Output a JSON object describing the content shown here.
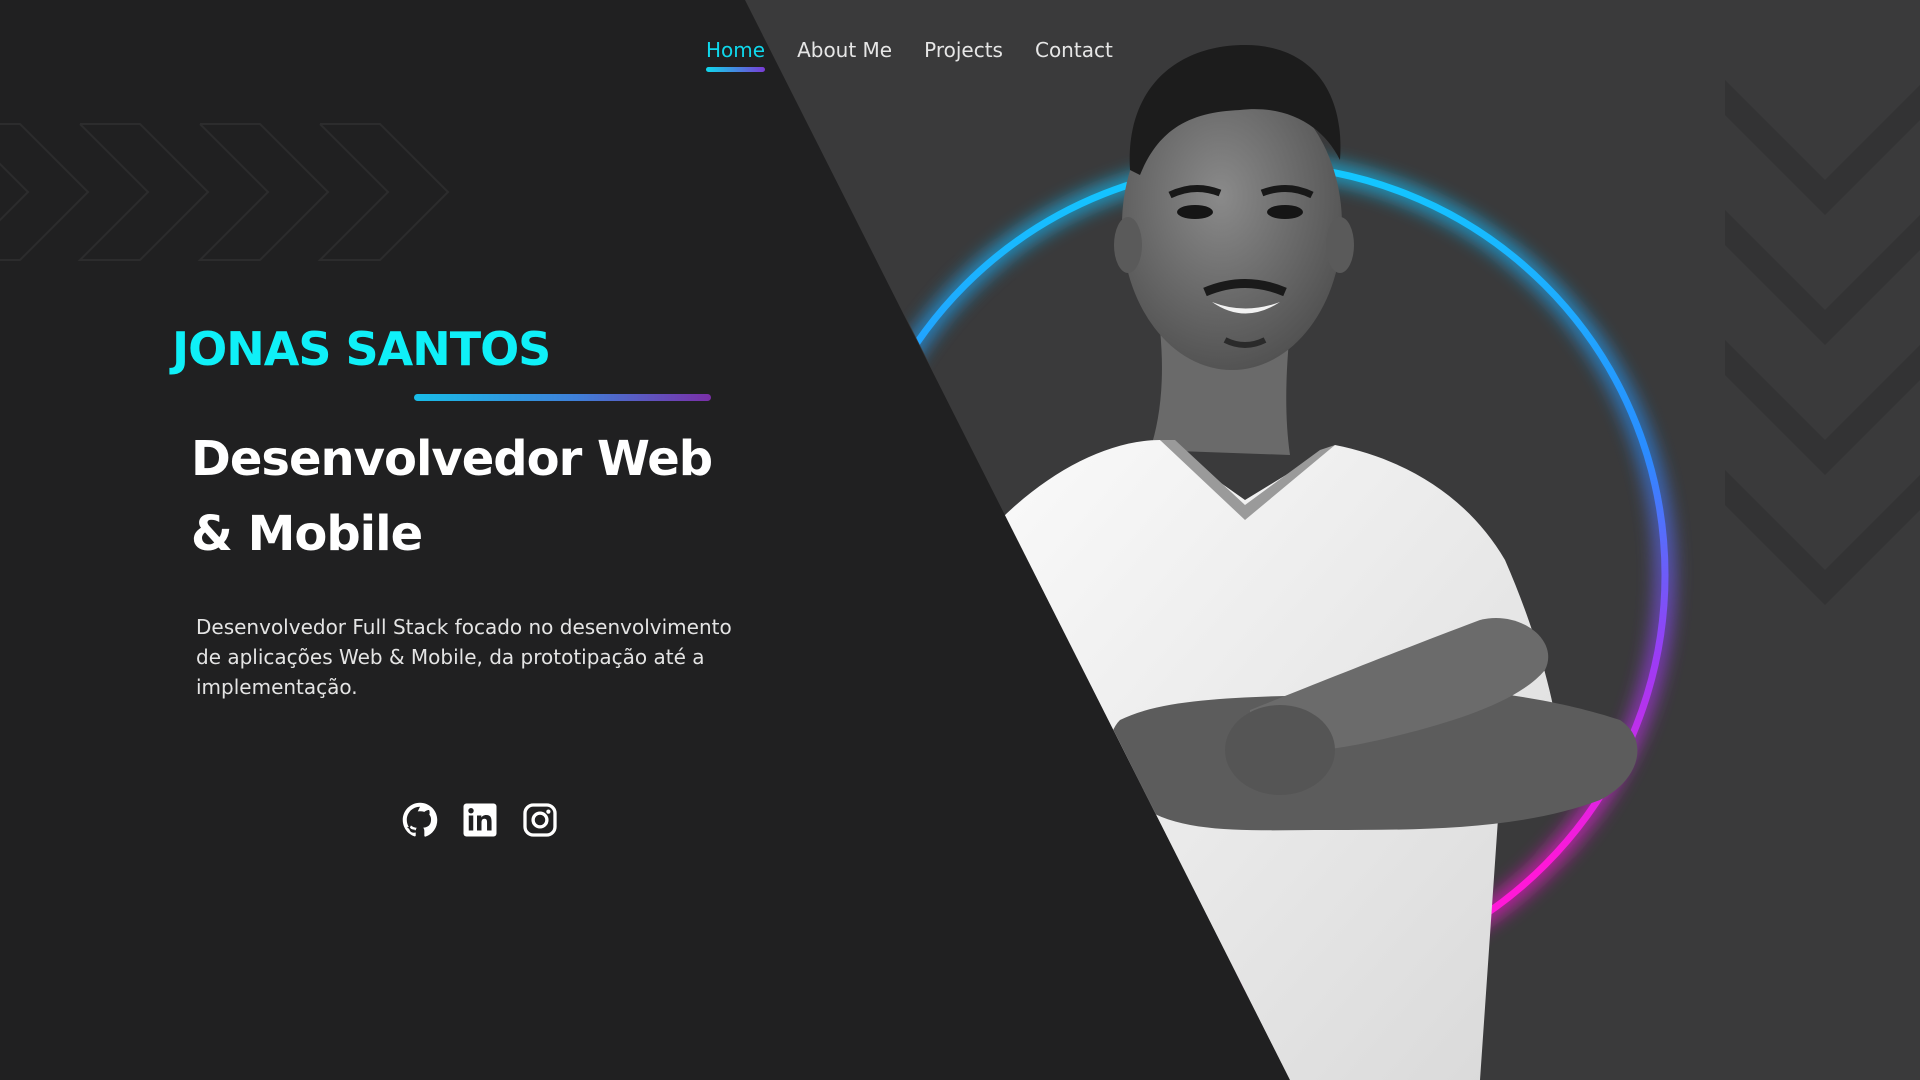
{
  "nav": {
    "items": [
      {
        "label": "Home",
        "active": true
      },
      {
        "label": "About Me",
        "active": false
      },
      {
        "label": "Projects",
        "active": false
      },
      {
        "label": "Contact",
        "active": false
      }
    ]
  },
  "hero": {
    "name": "JONAS SANTOS",
    "headline_line1": "Desenvolvedor Web",
    "headline_line2": "& Mobile",
    "description": "Desenvolvedor Full Stack focado no desenvolvimento de aplicações Web & Mobile, da prototipação até a implementação."
  },
  "socials": [
    {
      "icon": "github-icon"
    },
    {
      "icon": "linkedin-icon"
    },
    {
      "icon": "instagram-icon"
    }
  ],
  "colors": {
    "background_dark": "#202021",
    "background_panel": "#3a3a3b",
    "accent_cyan": "#0ff0f8",
    "accent_blue": "#12b4ff",
    "accent_magenta": "#ff1fd6",
    "text_light": "#e4e4e4"
  }
}
